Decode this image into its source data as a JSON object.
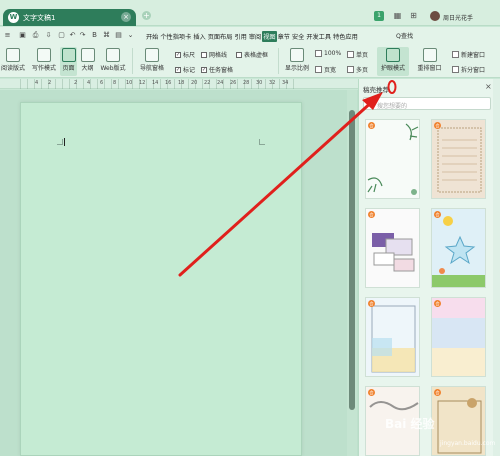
{
  "titlebar": {
    "doc_title": "文字文稿1",
    "tab_close": "×",
    "add_tab": "+",
    "badge": "1",
    "user_name": "周日光花手"
  },
  "menu": {
    "start": "开始",
    "items": [
      "个性指项卡",
      "插入",
      "页面布局",
      "引用",
      "审阅",
      "视图",
      "章节",
      "安全",
      "开发工具",
      "特色应用"
    ],
    "active": "视图",
    "search": "Q查找"
  },
  "toolbar": {
    "read_mode": "阅读版式",
    "write_mode": "写作模式",
    "page": "页面",
    "outline": "大纲",
    "web": "Web版式",
    "nav_pane": "导航窗格",
    "ruler": "标尺",
    "gridlines": "网格线",
    "table_gridlines": "表格虚框",
    "mark": "标记",
    "task_pane": "任务窗格",
    "display_ratio": "显示比例",
    "zoom_100": "100%",
    "one_page": "页宽",
    "single": "单页",
    "multi": "多页",
    "eye_mode": "护眼模式",
    "rearrange": "重排窗口",
    "new_window": "新建窗口",
    "split_window": "拆分窗口"
  },
  "ruler": {
    "numbers": [
      "4",
      "2",
      "2",
      "4",
      "6",
      "8",
      "10",
      "12",
      "14",
      "16",
      "18",
      "20",
      "22",
      "24",
      "26",
      "28",
      "30",
      "32",
      "34"
    ]
  },
  "panel": {
    "title": "稿壳推荐",
    "close": "×",
    "search_placeholder": "搜您想要的",
    "badge": "会"
  },
  "watermark": {
    "text": "Bai 经验",
    "sub": "jingyan.baidu.com"
  },
  "colors": {
    "accent": "#2e7d5b",
    "eye_green": "#c5ebd3",
    "arrow": "#e0201c"
  }
}
